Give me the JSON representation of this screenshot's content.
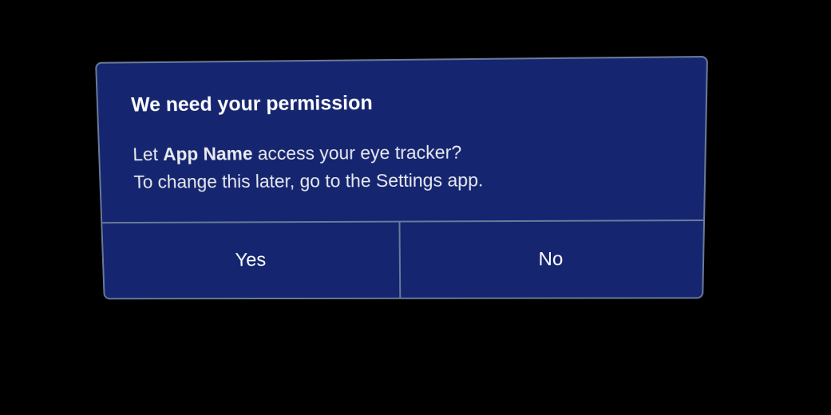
{
  "dialog": {
    "title": "We need your permission",
    "message": {
      "prefix": "Let ",
      "app_name": "App Name",
      "suffix": " access your eye tracker?",
      "line2": "To change this later, go to the Settings app."
    },
    "buttons": {
      "yes_label": "Yes",
      "no_label": "No"
    }
  }
}
